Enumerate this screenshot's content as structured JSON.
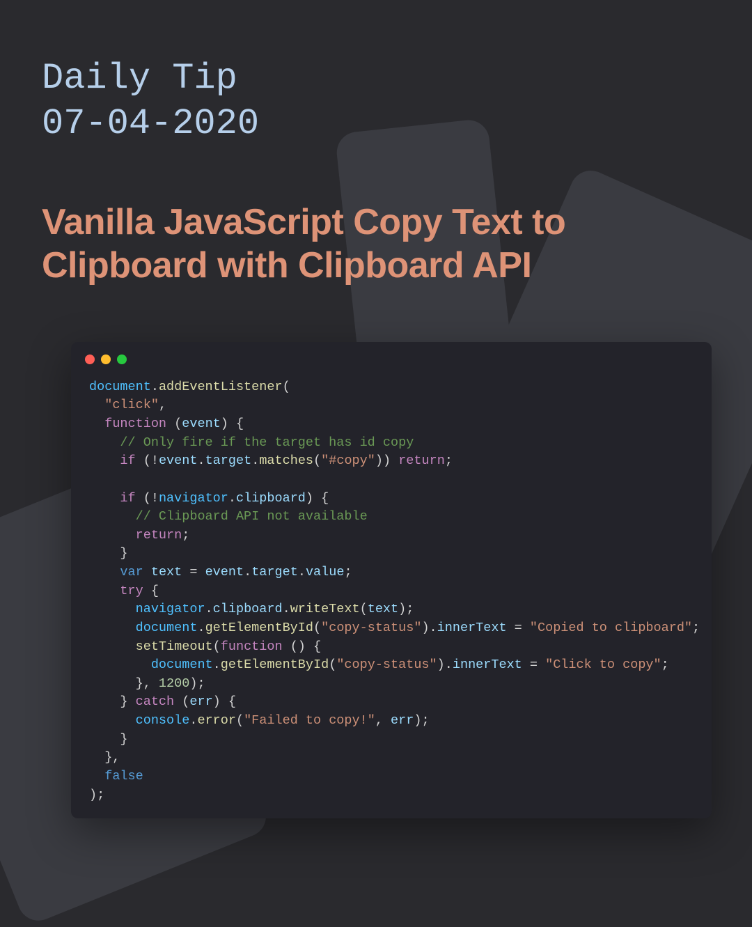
{
  "header": {
    "line1": "Daily Tip",
    "line2": "07-04-2020",
    "title": "Vanilla JavaScript Copy Text to Clipboard with Clipboard API"
  },
  "code": {
    "tokens": [
      [
        [
          "obj",
          "document"
        ],
        [
          "punc",
          "."
        ],
        [
          "method",
          "addEventListener"
        ],
        [
          "punc",
          "("
        ]
      ],
      [
        [
          "punc",
          "  "
        ],
        [
          "str",
          "\"click\""
        ],
        [
          "punc",
          ","
        ]
      ],
      [
        [
          "punc",
          "  "
        ],
        [
          "kw",
          "function"
        ],
        [
          "punc",
          " ("
        ],
        [
          "param",
          "event"
        ],
        [
          "punc",
          ") {"
        ]
      ],
      [
        [
          "punc",
          "    "
        ],
        [
          "comment",
          "// Only fire if the target has id copy"
        ]
      ],
      [
        [
          "punc",
          "    "
        ],
        [
          "kw",
          "if"
        ],
        [
          "punc",
          " (!"
        ],
        [
          "param",
          "event"
        ],
        [
          "punc",
          "."
        ],
        [
          "prop",
          "target"
        ],
        [
          "punc",
          "."
        ],
        [
          "method",
          "matches"
        ],
        [
          "punc",
          "("
        ],
        [
          "str",
          "\"#copy\""
        ],
        [
          "punc",
          "))"
        ],
        [
          "punc",
          " "
        ],
        [
          "kw",
          "return"
        ],
        [
          "punc",
          ";"
        ]
      ],
      [],
      [
        [
          "punc",
          "    "
        ],
        [
          "kw",
          "if"
        ],
        [
          "punc",
          " (!"
        ],
        [
          "obj",
          "navigator"
        ],
        [
          "punc",
          "."
        ],
        [
          "prop",
          "clipboard"
        ],
        [
          "punc",
          ") {"
        ]
      ],
      [
        [
          "punc",
          "      "
        ],
        [
          "comment",
          "// Clipboard API not available"
        ]
      ],
      [
        [
          "punc",
          "      "
        ],
        [
          "kw",
          "return"
        ],
        [
          "punc",
          ";"
        ]
      ],
      [
        [
          "punc",
          "    }"
        ]
      ],
      [
        [
          "punc",
          "    "
        ],
        [
          "var",
          "var"
        ],
        [
          "punc",
          " "
        ],
        [
          "prop",
          "text"
        ],
        [
          "punc",
          " = "
        ],
        [
          "param",
          "event"
        ],
        [
          "punc",
          "."
        ],
        [
          "prop",
          "target"
        ],
        [
          "punc",
          "."
        ],
        [
          "prop",
          "value"
        ],
        [
          "punc",
          ";"
        ]
      ],
      [
        [
          "punc",
          "    "
        ],
        [
          "kw",
          "try"
        ],
        [
          "punc",
          " {"
        ]
      ],
      [
        [
          "punc",
          "      "
        ],
        [
          "obj",
          "navigator"
        ],
        [
          "punc",
          "."
        ],
        [
          "prop",
          "clipboard"
        ],
        [
          "punc",
          "."
        ],
        [
          "method",
          "writeText"
        ],
        [
          "punc",
          "("
        ],
        [
          "prop",
          "text"
        ],
        [
          "punc",
          ");"
        ]
      ],
      [
        [
          "punc",
          "      "
        ],
        [
          "obj",
          "document"
        ],
        [
          "punc",
          "."
        ],
        [
          "method",
          "getElementById"
        ],
        [
          "punc",
          "("
        ],
        [
          "str",
          "\"copy-status\""
        ],
        [
          "punc",
          ")."
        ],
        [
          "prop",
          "innerText"
        ],
        [
          "punc",
          " = "
        ],
        [
          "str",
          "\"Copied to clipboard\""
        ],
        [
          "punc",
          ";"
        ]
      ],
      [
        [
          "punc",
          "      "
        ],
        [
          "method",
          "setTimeout"
        ],
        [
          "punc",
          "("
        ],
        [
          "kw",
          "function"
        ],
        [
          "punc",
          " () {"
        ]
      ],
      [
        [
          "punc",
          "        "
        ],
        [
          "obj",
          "document"
        ],
        [
          "punc",
          "."
        ],
        [
          "method",
          "getElementById"
        ],
        [
          "punc",
          "("
        ],
        [
          "str",
          "\"copy-status\""
        ],
        [
          "punc",
          ")."
        ],
        [
          "prop",
          "innerText"
        ],
        [
          "punc",
          " = "
        ],
        [
          "str",
          "\"Click to copy\""
        ],
        [
          "punc",
          ";"
        ]
      ],
      [
        [
          "punc",
          "      }, "
        ],
        [
          "num",
          "1200"
        ],
        [
          "punc",
          ");"
        ]
      ],
      [
        [
          "punc",
          "    } "
        ],
        [
          "kw",
          "catch"
        ],
        [
          "punc",
          " ("
        ],
        [
          "param",
          "err"
        ],
        [
          "punc",
          ") {"
        ]
      ],
      [
        [
          "punc",
          "      "
        ],
        [
          "obj",
          "console"
        ],
        [
          "punc",
          "."
        ],
        [
          "method",
          "error"
        ],
        [
          "punc",
          "("
        ],
        [
          "str",
          "\"Failed to copy!\""
        ],
        [
          "punc",
          ", "
        ],
        [
          "param",
          "err"
        ],
        [
          "punc",
          ");"
        ]
      ],
      [
        [
          "punc",
          "    }"
        ]
      ],
      [
        [
          "punc",
          "  },"
        ]
      ],
      [
        [
          "punc",
          "  "
        ],
        [
          "const",
          "false"
        ]
      ],
      [
        [
          "punc",
          ");"
        ]
      ]
    ]
  }
}
